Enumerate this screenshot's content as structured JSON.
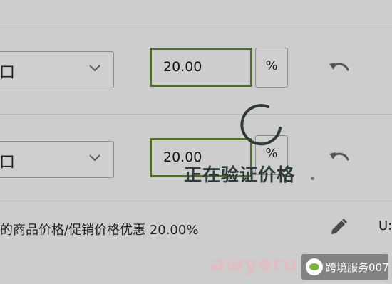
{
  "rows": [
    {
      "select_value": "口",
      "percent_value": "20.00",
      "percent_sign": "%"
    },
    {
      "select_value": "口",
      "percent_value": "20.00",
      "percent_sign": "%"
    }
  ],
  "promotion_summary": "的商品价格/促销价格优惠 20.00%",
  "cut_off_text": "U:",
  "loading_text": "正在验证价格",
  "watermark": {
    "text": "awyeru",
    "badge_text": "跨境服务007"
  },
  "colors": {
    "input_border": "#4f6b2b",
    "spinner": "#2f3b3b",
    "background": "#cdcdcd"
  }
}
